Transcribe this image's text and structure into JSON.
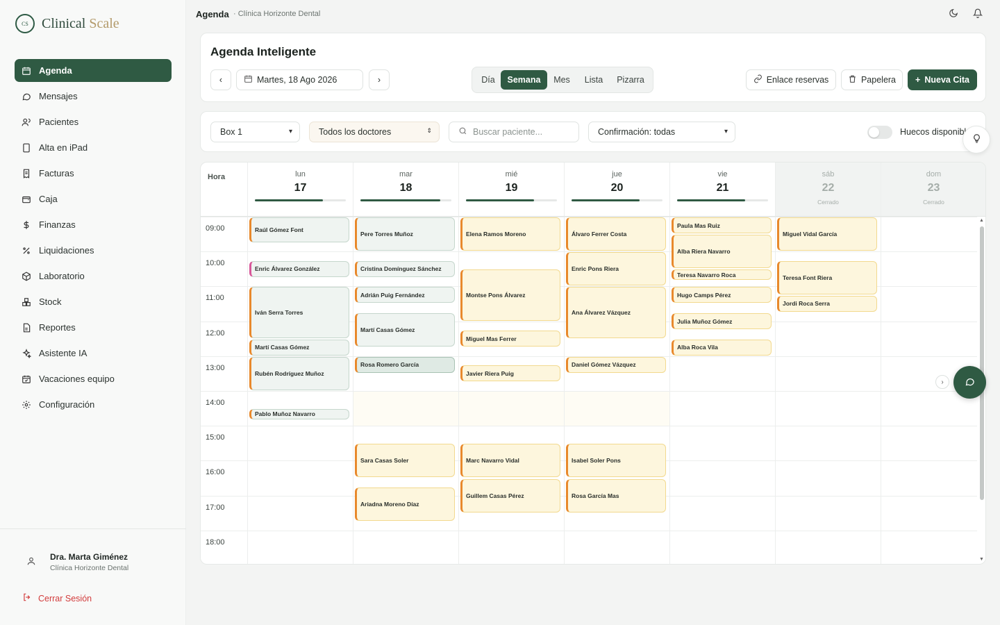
{
  "brand": {
    "mark": "CS",
    "name_main": "Clinical ",
    "name_accent": "Scale"
  },
  "header": {
    "title": "Agenda",
    "subtitle": "· Clínica Horizonte Dental"
  },
  "nav": [
    {
      "label": "Agenda",
      "icon": "calendar-icon",
      "active": true
    },
    {
      "label": "Mensajes",
      "icon": "message-icon"
    },
    {
      "label": "Pacientes",
      "icon": "users-icon"
    },
    {
      "label": "Alta en iPad",
      "icon": "tablet-icon"
    },
    {
      "label": "Facturas",
      "icon": "invoice-icon"
    },
    {
      "label": "Caja",
      "icon": "wallet-icon"
    },
    {
      "label": "Finanzas",
      "icon": "dollar-icon"
    },
    {
      "label": "Liquidaciones",
      "icon": "percent-icon"
    },
    {
      "label": "Laboratorio",
      "icon": "box-icon"
    },
    {
      "label": "Stock",
      "icon": "boxes-icon"
    },
    {
      "label": "Reportes",
      "icon": "report-icon"
    },
    {
      "label": "Asistente IA",
      "icon": "sparkles-icon"
    },
    {
      "label": "Vacaciones equipo",
      "icon": "calendar-check-icon"
    },
    {
      "label": "Configuración",
      "icon": "gear-icon"
    }
  ],
  "user": {
    "name": "Dra. Marta Giménez",
    "clinic": "Clínica Horizonte Dental",
    "logout": "Cerrar Sesión"
  },
  "toolbar": {
    "title": "Agenda Inteligente",
    "date": "Martes, 18 Ago 2026",
    "views": [
      "Día",
      "Semana",
      "Mes",
      "Lista",
      "Pizarra"
    ],
    "active_view": "Semana",
    "booking_link": "Enlace reservas",
    "trash": "Papelera",
    "new_appt": "Nueva Cita"
  },
  "filters": {
    "box": "Box 1",
    "doctors": "Todos los doctores",
    "search_placeholder": "Buscar paciente...",
    "confirmation": "Confirmación: todas",
    "slots_toggle": "Huecos disponibles"
  },
  "calendar": {
    "hora_label": "Hora",
    "closed_label": "Cerrado",
    "hours": [
      "09:00",
      "10:00",
      "11:00",
      "12:00",
      "13:00",
      "14:00",
      "15:00",
      "16:00",
      "17:00",
      "18:00"
    ],
    "days": [
      {
        "name": "lun",
        "num": "17",
        "progress": 0.75
      },
      {
        "name": "mar",
        "num": "18",
        "progress": 0.88
      },
      {
        "name": "mié",
        "num": "19",
        "progress": 0.75
      },
      {
        "name": "jue",
        "num": "20",
        "progress": 0.75
      },
      {
        "name": "vie",
        "num": "21",
        "progress": 0.75
      },
      {
        "name": "sáb",
        "num": "22",
        "closed": true
      },
      {
        "name": "dom",
        "num": "23",
        "closed": true
      }
    ],
    "appointments": [
      {
        "day": 0,
        "start": 9.0,
        "end": 9.75,
        "name": "Raúl Gómez Font",
        "style": "g"
      },
      {
        "day": 0,
        "start": 10.25,
        "end": 10.75,
        "name": "Enric Álvarez González",
        "style": "gp"
      },
      {
        "day": 0,
        "start": 11.0,
        "end": 12.5,
        "name": "Iván Serra Torres",
        "style": "g"
      },
      {
        "day": 0,
        "start": 12.5,
        "end": 13.0,
        "name": "Martí Casas Gómez",
        "style": "g"
      },
      {
        "day": 0,
        "start": 13.0,
        "end": 14.0,
        "name": "Rubén Rodríguez Muñoz",
        "style": "g"
      },
      {
        "day": 0,
        "start": 14.5,
        "end": 14.83,
        "name": "Pablo Muñoz Navarro",
        "style": "g"
      },
      {
        "day": 1,
        "start": 9.0,
        "end": 10.0,
        "name": "Pere Torres Muñoz",
        "style": "g"
      },
      {
        "day": 1,
        "start": 10.25,
        "end": 10.75,
        "name": "Cristina Domínguez Sánchez",
        "style": "g"
      },
      {
        "day": 1,
        "start": 11.0,
        "end": 11.5,
        "name": "Adrián Puig Fernández",
        "style": "g"
      },
      {
        "day": 1,
        "start": 11.75,
        "end": 12.75,
        "name": "Martí Casas Gómez",
        "style": "g"
      },
      {
        "day": 1,
        "start": 13.0,
        "end": 13.5,
        "name": "Rosa Romero García",
        "style": "gs"
      },
      {
        "day": 1,
        "start": 15.5,
        "end": 16.5,
        "name": "Sara Casas Soler",
        "style": "y"
      },
      {
        "day": 1,
        "start": 16.75,
        "end": 17.75,
        "name": "Ariadna Moreno Díaz",
        "style": "y"
      },
      {
        "day": 2,
        "start": 9.0,
        "end": 10.0,
        "name": "Elena Ramos Moreno",
        "style": "y"
      },
      {
        "day": 2,
        "start": 10.5,
        "end": 12.0,
        "name": "Montse Pons Álvarez",
        "style": "y"
      },
      {
        "day": 2,
        "start": 12.25,
        "end": 12.75,
        "name": "Miguel Mas Ferrer",
        "style": "y"
      },
      {
        "day": 2,
        "start": 13.25,
        "end": 13.75,
        "name": "Javier Riera Puig",
        "style": "y"
      },
      {
        "day": 2,
        "start": 15.5,
        "end": 16.5,
        "name": "Marc Navarro Vidal",
        "style": "y"
      },
      {
        "day": 2,
        "start": 16.5,
        "end": 17.5,
        "name": "Guillem Casas Pérez",
        "style": "y"
      },
      {
        "day": 3,
        "start": 9.0,
        "end": 10.0,
        "name": "Álvaro Ferrer Costa",
        "style": "y"
      },
      {
        "day": 3,
        "start": 10.0,
        "end": 11.0,
        "name": "Enric Pons Riera",
        "style": "y"
      },
      {
        "day": 3,
        "start": 11.0,
        "end": 12.5,
        "name": "Ana Álvarez Vázquez",
        "style": "y"
      },
      {
        "day": 3,
        "start": 13.0,
        "end": 13.5,
        "name": "Daniel Gómez Vázquez",
        "style": "y"
      },
      {
        "day": 3,
        "start": 15.5,
        "end": 16.5,
        "name": "Isabel Soler Pons",
        "style": "y"
      },
      {
        "day": 3,
        "start": 16.5,
        "end": 17.5,
        "name": "Rosa García Mas",
        "style": "y"
      },
      {
        "day": 4,
        "start": 9.0,
        "end": 9.5,
        "name": "Paula Mas Ruiz",
        "style": "y"
      },
      {
        "day": 4,
        "start": 9.5,
        "end": 10.5,
        "name": "Alba Riera Navarro",
        "style": "y"
      },
      {
        "day": 4,
        "start": 10.5,
        "end": 10.83,
        "name": "Teresa Navarro Roca",
        "style": "y"
      },
      {
        "day": 4,
        "start": 11.0,
        "end": 11.5,
        "name": "Hugo Camps Pérez",
        "style": "y"
      },
      {
        "day": 4,
        "start": 11.75,
        "end": 12.25,
        "name": "Julia Muñoz Gómez",
        "style": "y"
      },
      {
        "day": 4,
        "start": 12.5,
        "end": 13.0,
        "name": "Alba Roca Vila",
        "style": "y"
      },
      {
        "day": 5,
        "start": 9.0,
        "end": 10.0,
        "name": "Miguel Vidal García",
        "style": "y"
      },
      {
        "day": 5,
        "start": 10.25,
        "end": 11.25,
        "name": "Teresa Font Riera",
        "style": "y"
      },
      {
        "day": 5,
        "start": 11.25,
        "end": 11.75,
        "name": "Jordi Roca Serra",
        "style": "y"
      }
    ]
  },
  "colors": {
    "primary": "#2f5a43",
    "accent_orange": "#e8892c",
    "accent_pink": "#d8589a",
    "danger": "#d23b3b"
  }
}
